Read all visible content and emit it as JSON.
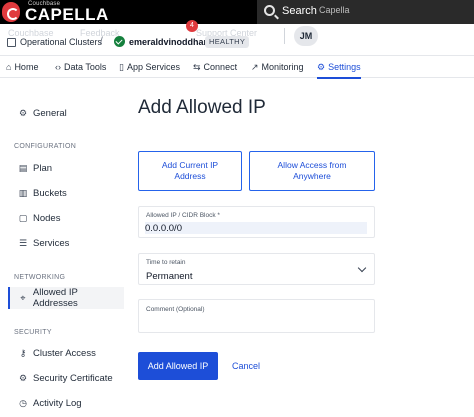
{
  "brand": {
    "small": "Couchbase",
    "name": "CAPELLA",
    "accent": "#e03a3e"
  },
  "search": {
    "label": "Search",
    "placeholder": "Capella"
  },
  "orgbar": {
    "ghost_1": "Couchbase",
    "ghost_2": "Feedback",
    "ghost_3": "Support Center",
    "org_label": "Operational Clusters",
    "separator": "/",
    "cluster_name": "emeraldvinoddham",
    "status": "HEALTHY",
    "notifications": "4",
    "user_initials": "JM"
  },
  "nav": {
    "tabs": [
      {
        "label": "Home",
        "icon": "home-icon"
      },
      {
        "label": "Data Tools",
        "icon": "data-tools-icon"
      },
      {
        "label": "App Services",
        "icon": "app-services-icon"
      },
      {
        "label": "Connect",
        "icon": "connect-icon"
      },
      {
        "label": "Monitoring",
        "icon": "monitoring-icon"
      },
      {
        "label": "Settings",
        "icon": "settings-icon",
        "active": true
      }
    ]
  },
  "sidebar": {
    "general": "General",
    "sections": {
      "configuration": "CONFIGURATION",
      "networking": "NETWORKING",
      "security": "SECURITY"
    },
    "items": [
      {
        "label": "Plan",
        "icon": "plan-icon"
      },
      {
        "label": "Buckets",
        "icon": "buckets-icon"
      },
      {
        "label": "Nodes",
        "icon": "nodes-icon"
      },
      {
        "label": "Services",
        "icon": "services-icon"
      },
      {
        "label": "Allowed IP Addresses",
        "icon": "location-pin-icon",
        "active": true
      },
      {
        "label": "Cluster Access",
        "icon": "key-icon"
      },
      {
        "label": "Security Certificate",
        "icon": "certificate-icon"
      },
      {
        "label": "Activity Log",
        "icon": "activity-log-icon"
      }
    ]
  },
  "main": {
    "title": "Add Allowed IP",
    "add_current_ip": "Add Current IP Address",
    "allow_anywhere": "Allow Access from Anywhere",
    "cidr": {
      "label": "Allowed IP / CIDR Block *",
      "value": "0.0.0.0/0"
    },
    "retain": {
      "label": "Time to retain",
      "value": "Permanent"
    },
    "comment": {
      "label": "Comment (Optional)",
      "value": ""
    },
    "submit": "Add Allowed IP",
    "cancel": "Cancel"
  },
  "colors": {
    "primary": "#1d4ed8",
    "healthy": "#15803d",
    "topbar": "#000000"
  }
}
